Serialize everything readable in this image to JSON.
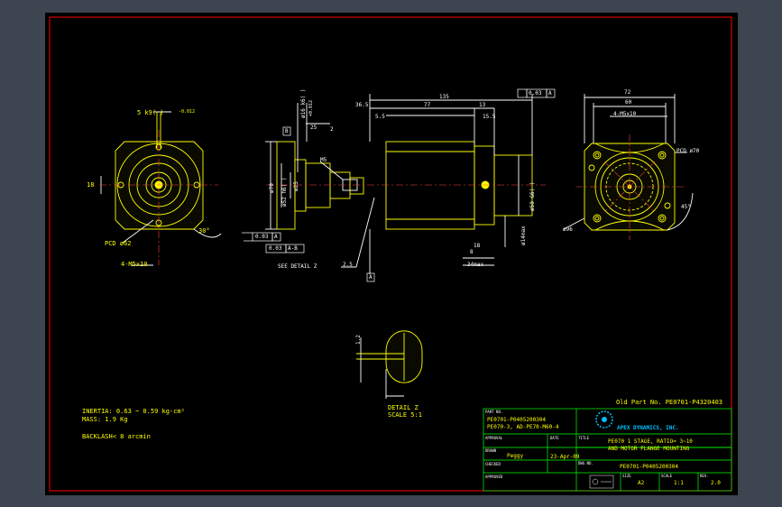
{
  "colors": {
    "background": "#3d4551",
    "viewport": "#000000",
    "border": "#ff0000",
    "geometry": "#ffff00",
    "dimension": "#ffffff",
    "centerline": "#ff4040",
    "titleblock": "#00ff00",
    "hatch": "#ff00ff",
    "logo": "#00c0ff"
  },
  "dimensions": {
    "front": [
      "5 k9(  )",
      "-0.012",
      "18",
      "PCD ø62",
      "4-M5x10",
      "30°"
    ],
    "side": {
      "overall": "135",
      "d36_5": "36.5",
      "d77": "77",
      "d13": "13",
      "d15_5": "15.5",
      "d5_5": "5.5",
      "d25": "25",
      "d2": "2",
      "d2_5": "2.5",
      "d34max": "34max",
      "d8": "8",
      "d18": "18",
      "shaft_dia": "ø16 k6(  )",
      "shaft_tol": "+0.012",
      "pilot_dia": "ø52 h6(  )",
      "d70": "ø70",
      "d25dia": "ø25",
      "m5": "M5",
      "motor_pilot": "ø50 G6(  )",
      "motor_max": "ø14max",
      "datum_b": "B",
      "datum_a": "A",
      "tol1_val": "0.03",
      "tol1_ref": "A",
      "tol2_val": "0.03",
      "tol2_ref": "A-B",
      "par_val": "0.03",
      "par_ref": "A",
      "see_detail": "SEE DETAIL Z"
    },
    "rear": [
      "72",
      "60",
      "4-M5x10",
      "PCD ø70",
      "ø96",
      "45°"
    ]
  },
  "detail": {
    "dim": "1.2",
    "title": "DETAIL Z",
    "scale": "SCALE 5:1"
  },
  "notes": {
    "inertia": "INERTIA: 0.63 ~ 0.59 kg-cm²",
    "mass": "MASS: 1.9 Kg",
    "backlash": "BACKLASH< 8 arcmin"
  },
  "title_block": {
    "old_part": "Old Part No. PE0701-P4320403",
    "part_no_label": "PART NO.",
    "part_no_1": "PE0701-P0405200304",
    "part_no_2": "PE070-3, AD-PE70-M60-4",
    "approval_label": "APPROVAL",
    "date_label": "DATE",
    "company": "APEX DYNAMICS, INC.",
    "title_label": "TITLE",
    "title_1": "PE070 1 STAGE, RATIO= 3~10",
    "title_2": "AND MOTOR FLANGE MOUNTING",
    "drawn_label": "DRAWN",
    "drawn": "Peggy",
    "drawn_date": "23-Apr-09",
    "dwg_label": "DWG NO.",
    "dwg_no": "PE0701-P0405200304",
    "checked_label": "CHECKED",
    "approved_label": "APPROVED",
    "size_label": "SIZE",
    "size": "A2",
    "scale_label": "SCALE",
    "scale": "1:1",
    "rev_label": "REV.",
    "rev": "2.0"
  }
}
